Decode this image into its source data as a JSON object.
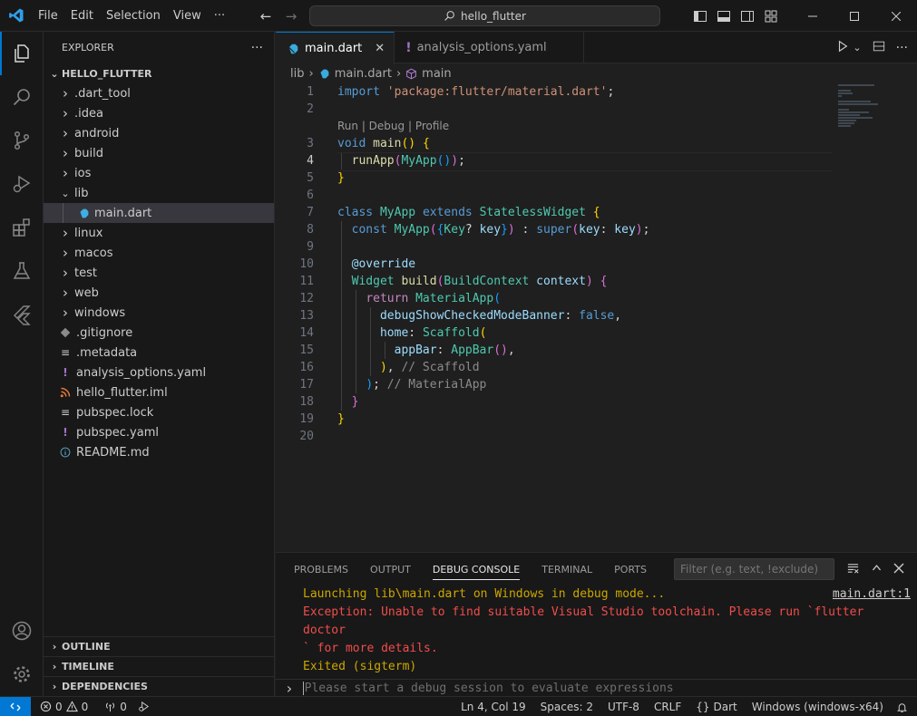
{
  "titlebar": {
    "menu": [
      "File",
      "Edit",
      "Selection",
      "View"
    ],
    "more": "···",
    "search_text": "hello_flutter"
  },
  "sidebar": {
    "title": "EXPLORER",
    "more": "···",
    "root": "HELLO_FLUTTER",
    "items": [
      {
        "label": ".dart_tool",
        "kind": "folder"
      },
      {
        "label": ".idea",
        "kind": "folder"
      },
      {
        "label": "android",
        "kind": "folder"
      },
      {
        "label": "build",
        "kind": "folder"
      },
      {
        "label": "ios",
        "kind": "folder"
      },
      {
        "label": "lib",
        "kind": "folder-open"
      },
      {
        "label": "main.dart",
        "kind": "dart-file"
      },
      {
        "label": "linux",
        "kind": "folder"
      },
      {
        "label": "macos",
        "kind": "folder"
      },
      {
        "label": "test",
        "kind": "folder"
      },
      {
        "label": "web",
        "kind": "folder"
      },
      {
        "label": "windows",
        "kind": "folder"
      },
      {
        "label": ".gitignore",
        "kind": "git-file"
      },
      {
        "label": ".metadata",
        "kind": "metadata-file"
      },
      {
        "label": "analysis_options.yaml",
        "kind": "yaml-file"
      },
      {
        "label": "hello_flutter.iml",
        "kind": "rss-file"
      },
      {
        "label": "pubspec.lock",
        "kind": "lock-file"
      },
      {
        "label": "pubspec.yaml",
        "kind": "yaml-file"
      },
      {
        "label": "README.md",
        "kind": "info-file"
      }
    ],
    "sections": [
      "OUTLINE",
      "TIMELINE",
      "DEPENDENCIES"
    ]
  },
  "editor": {
    "tabs": [
      {
        "label": "main.dart",
        "active": true
      },
      {
        "label": "analysis_options.yaml",
        "active": false
      }
    ],
    "breadcrumbs": [
      "lib",
      "main.dart",
      "main"
    ],
    "codelens": "Run | Debug | Profile",
    "line_numbers": [
      "1",
      "2",
      "3",
      "4",
      "5",
      "6",
      "7",
      "8",
      "9",
      "10",
      "11",
      "12",
      "13",
      "14",
      "15",
      "16",
      "17",
      "18",
      "19",
      "20"
    ],
    "code": {
      "l1_import": "import",
      "l1_str": "'package:flutter/material.dart'",
      "l1_end": ";",
      "l3_void": "void",
      "l3_main": "main",
      "l4_runapp": "runApp",
      "l4_myapp": "MyApp",
      "l7_class": "class",
      "l7_myapp": "MyApp",
      "l7_extends": "extends",
      "l7_stateless": "StatelessWidget",
      "l8_const": "const",
      "l8_myapp": "MyApp",
      "l8_keytype": "Key",
      "l8_key": "key",
      "l8_super": "super",
      "l8_key2": "key",
      "l8_key3": "key",
      "l10_override": "@override",
      "l11_widget": "Widget",
      "l11_build": "build",
      "l11_buildcontext": "BuildContext",
      "l11_context": "context",
      "l12_return": "return",
      "l12_materialapp": "MaterialApp",
      "l13_debug": "debugShowCheckedModeBanner",
      "l13_false": "false",
      "l14_home": "home",
      "l14_scaffold": "Scaffold",
      "l15_appbar": "appBar",
      "l15_appbarcls": "AppBar",
      "l16_cmt": "// Scaffold",
      "l17_cmt": "// MaterialApp"
    }
  },
  "panel": {
    "tabs": [
      "PROBLEMS",
      "OUTPUT",
      "DEBUG CONSOLE",
      "TERMINAL",
      "PORTS"
    ],
    "active_tab": "DEBUG CONSOLE",
    "filter_placeholder": "Filter (e.g. text, !exclude)",
    "console": {
      "line1": "Launching lib\\main.dart on Windows in debug mode...",
      "link": "main.dart:1",
      "line2": "Exception: Unable to find suitable Visual Studio toolchain. Please run `flutter doctor",
      "line3": "` for more details.",
      "line4": "Exited (sigterm)"
    },
    "repl_placeholder": "Please start a debug session to evaluate expressions"
  },
  "statusbar": {
    "errors": "0",
    "warnings": "0",
    "ports": "0",
    "cursor": "Ln 4, Col 19",
    "spaces": "Spaces: 2",
    "encoding": "UTF-8",
    "eol": "CRLF",
    "language": "Dart",
    "device": "Windows (windows-x64)"
  }
}
